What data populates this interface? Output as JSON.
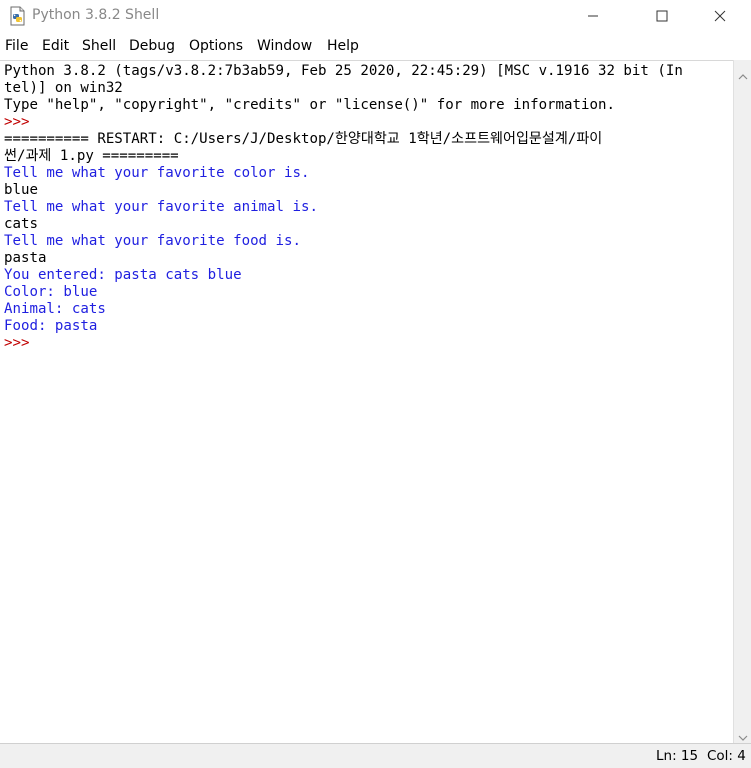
{
  "window": {
    "title": "Python 3.8.2 Shell",
    "icon": "python-file-icon",
    "controls": [
      "minimize-icon",
      "maximize-icon",
      "close-icon"
    ]
  },
  "menu": [
    "File",
    "Edit",
    "Shell",
    "Debug",
    "Options",
    "Window",
    "Help"
  ],
  "colors": {
    "stdout": "#1f1fe0",
    "prompt": "#c00000",
    "text": "#000000",
    "title_text": "#888888"
  },
  "shell": {
    "lines": [
      {
        "text": "Python 3.8.2 (tags/v3.8.2:7b3ab59, Feb 25 2020, 22:45:29) [MSC v.1916 32 bit (In",
        "style": "default"
      },
      {
        "text": "tel)] on win32",
        "style": "default"
      },
      {
        "text": "Type \"help\", \"copyright\", \"credits\" or \"license()\" for more information.",
        "style": "default"
      },
      {
        "text": ">>> ",
        "style": "prompt"
      },
      {
        "text": "========== RESTART: C:/Users/J/Desktop/한양대학교 1학년/소프트웨어입문설계/파이",
        "style": "default"
      },
      {
        "text": "썬/과제 1.py =========",
        "style": "default"
      },
      {
        "text": "Tell me what your favorite color is.",
        "style": "stdout"
      },
      {
        "text": "blue",
        "style": "default"
      },
      {
        "text": "Tell me what your favorite animal is.",
        "style": "stdout"
      },
      {
        "text": "cats",
        "style": "default"
      },
      {
        "text": "Tell me what your favorite food is.",
        "style": "stdout"
      },
      {
        "text": "pasta",
        "style": "default"
      },
      {
        "text": "You entered: pasta cats blue",
        "style": "stdout"
      },
      {
        "text": "Color: blue",
        "style": "stdout"
      },
      {
        "text": "Animal: cats",
        "style": "stdout"
      },
      {
        "text": "Food: pasta",
        "style": "stdout"
      },
      {
        "text": ">>> ",
        "style": "prompt"
      }
    ]
  },
  "status": {
    "line": "Ln: 15",
    "col": "Col: 4"
  }
}
